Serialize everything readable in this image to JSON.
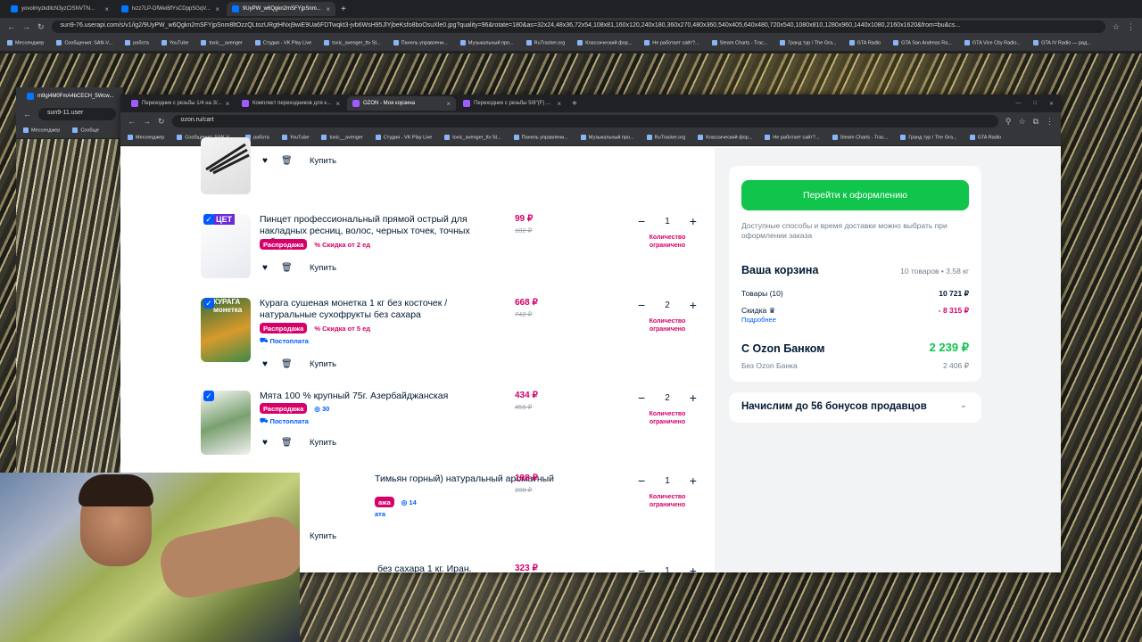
{
  "outer_browser": {
    "tabs": [
      {
        "label": "yovolmyzkdllcN3yzCISNVTN..."
      },
      {
        "label": "lvzz7LP-DfWeiBfYsCDppSGqV..."
      },
      {
        "label": "9UyPW_w6Qgkn2mSFYjpSnm..."
      }
    ],
    "url": "sun9-76.userapi.com/s/v1/ig2/9UyPW_w6Qgkn2mSFYjpSnm8ltOzzQLtozURgtHNxj9wiE9Ua6FDTwqkt3-jvb6WsH95JlYjbeKsfo8boOsuXle0.jpg?quality=96&rotate=180&as=32x24,48x36,72x54,108x81,160x120,240x180,360x270,480x360,540x405,640x480,720x540,1080x810,1280x960,1440x1080,2160x1620&from=bu&cs...",
    "bookmarks": [
      "Мессенджер",
      "Сообщения: SAN-V...",
      "работа",
      "YouTube",
      "toxic__avenger",
      "Студия - VK Play Live",
      "toxic_avenger_ttv St...",
      "Панель управлени...",
      "Музыкальный про...",
      "RuTracker.org",
      "Классический фор...",
      "Не работает сайт?...",
      "Steam Charts - Trac...",
      "Гранд тур / The Gra...",
      "GTA Radio",
      "GTA San Andreas Ra...",
      "GTA Vice City Radio...",
      "GTA IV Radio — рад..."
    ]
  },
  "middle_browser": {
    "tab": "m9gl4M0FmA4bCECH_5Wcw...",
    "url": "sun9-11.user",
    "bookmarks": [
      "Мессенджер",
      "Сообще"
    ]
  },
  "front_browser": {
    "tabs": [
      {
        "label": "Переходник с резьбы 1/4 на 3/..."
      },
      {
        "label": "Комплект переходников для к..."
      },
      {
        "label": "OZON - Моя корзина"
      },
      {
        "label": "Переходник с резьбы 5/8\"(F) ..."
      }
    ],
    "url": "ozon.ru/cart",
    "bookmarks": [
      "Мессенджер",
      "Сообщения: SAN-V...",
      "работа",
      "YouTube",
      "toxic__avenger",
      "Студия - VK Play Live",
      "toxic_avenger_ttv St...",
      "Панель управлени...",
      "Музыкальный про...",
      "RuTracker.org",
      "Классический фор...",
      "Не работает сайт?...",
      "Steam Charts - Trac...",
      "Гранд тур / The Gra...",
      "GTA Radio"
    ]
  },
  "cart": {
    "buy_label": "Купить",
    "first_row_buy": "Купить",
    "items": [
      {
        "thumb": "ЦЕТ",
        "title": "Пинцет профессиональный прямой острый для накладных ресниц, волос, черных точек, точных работ",
        "badge": "Распродажа",
        "extra": "Скидка от 2 ед",
        "price": "99 ₽",
        "old": "102 ₽",
        "qty": "1",
        "limit": "Количество ограничено"
      },
      {
        "thumb": "КУРАГА монетка",
        "title": "Курага сушеная монетка 1 кг без косточек / натуральные сухофрукты без сахара",
        "badge": "Распродажа",
        "extra": "Скидка от 5 ед",
        "postpay": "Постоплата",
        "price": "668 ₽",
        "old": "742 ₽",
        "qty": "2",
        "limit": "Количество ограничено"
      },
      {
        "thumb": "",
        "title": "Мята 100 % крупный 75г. Азербайджанская",
        "badge": "Распродажа",
        "bonus": "30",
        "postpay": "Постоплата",
        "price": "434 ₽",
        "old": "456 ₽",
        "qty": "2",
        "limit": "Количество ограничено"
      },
      {
        "thumb": "",
        "title": "Тимьян горный) натуральный ароматный",
        "badge": "ажа",
        "bonus": "14",
        "postpay": "ата",
        "price": "198 ₽",
        "old": "208 ₽",
        "qty": "1",
        "limit": "Количество ограничено"
      },
      {
        "title": "без сахара 1 кг. Иран.",
        "price": "323 ₽",
        "qty": "1"
      }
    ]
  },
  "summary": {
    "checkout": "Перейти к оформлению",
    "delivery_note": "Доступные способы и время доставки можно выбрать при оформлении заказа",
    "cart_title": "Ваша корзина",
    "cart_meta": "10 товаров • 3.58 кг",
    "goods_label": "Товары (10)",
    "goods_value": "10 721 ₽",
    "discount_label": "Скидка",
    "discount_value": "- 8 315 ₽",
    "details": "Подробнее",
    "bank_label": "С Ozon Банком",
    "bank_value": "2 239 ₽",
    "nobank_label": "Без Ozon Банка",
    "nobank_value": "2 406 ₽",
    "bonus_text": "Начислим до 56 бонусов продавцов"
  },
  "colors": {
    "accent": "#005bff",
    "sale": "#d6006a",
    "go": "#10c44c"
  }
}
